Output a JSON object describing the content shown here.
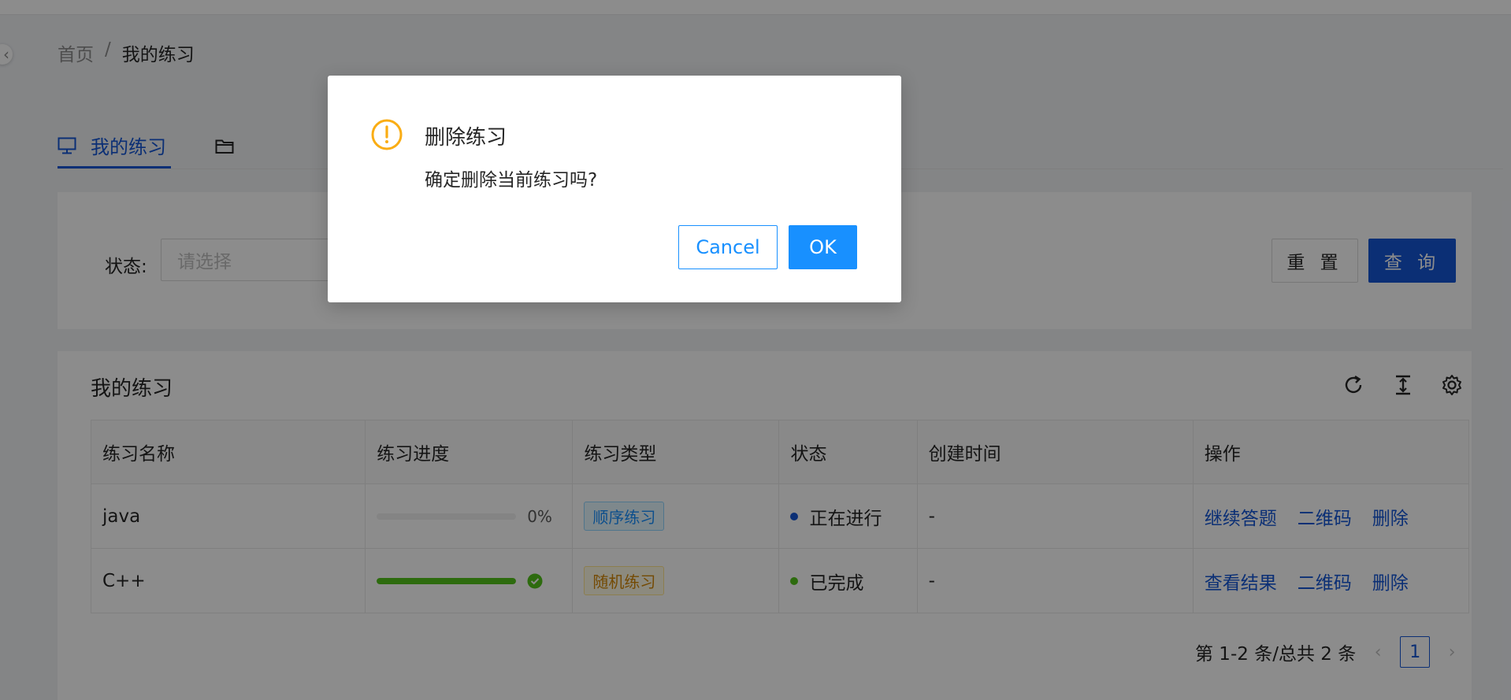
{
  "breadcrumb": {
    "home": "首页",
    "separator": "/",
    "current": "我的练习"
  },
  "tabs": {
    "active_label": "我的练习",
    "active_icon": "monitor-icon",
    "folder_icon": "folder-icon"
  },
  "search": {
    "status_label": "状态:",
    "status_placeholder": "请选择",
    "reset_label": "重 置",
    "query_label": "查 询"
  },
  "table": {
    "title": "我的练习",
    "toolbar_icons": [
      "reload-icon",
      "column-height-icon",
      "setting-icon"
    ],
    "columns": [
      "练习名称",
      "练习进度",
      "练习类型",
      "状态",
      "创建时间",
      "操作"
    ],
    "rows": [
      {
        "name": "java",
        "progress": 0,
        "progress_text": "0%",
        "type": "顺序练习",
        "status": "正在进行",
        "status_color": "#1557d6",
        "created": "-",
        "actions": [
          "继续答题",
          "二维码",
          "删除"
        ]
      },
      {
        "name": "C++",
        "progress": 100,
        "progress_icon": "check-circle-icon",
        "type": "随机练习",
        "status": "已完成",
        "status_color": "#52c41a",
        "created": "-",
        "actions": [
          "查看结果",
          "二维码",
          "删除"
        ]
      }
    ]
  },
  "pagination": {
    "summary": "第 1-2 条/总共 2 条",
    "current_page": "1"
  },
  "modal": {
    "title": "删除练习",
    "content": "确定删除当前练习吗?",
    "cancel_label": "Cancel",
    "ok_label": "OK",
    "icon": "exclamation-circle-icon"
  },
  "colors": {
    "primary": "#1557d6",
    "modal_primary": "#1890ff",
    "warning": "#faad14",
    "success": "#52c41a"
  }
}
